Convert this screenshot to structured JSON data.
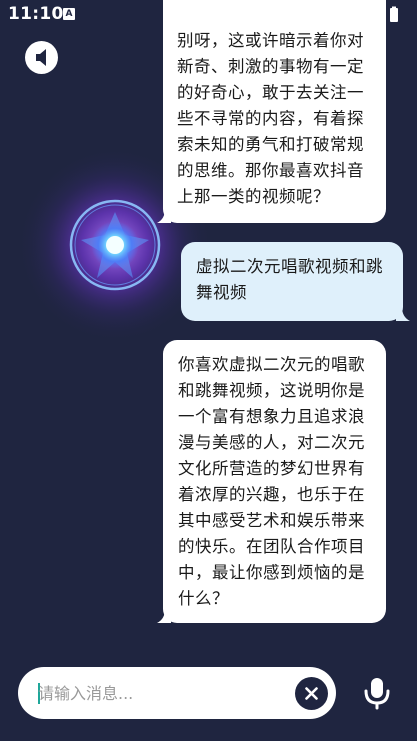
{
  "status_bar": {
    "time": "11:10",
    "app_icon_label": "A"
  },
  "chat": {
    "messages": [
      {
        "role": "ai",
        "text": "别呀，这或许暗示着你对新奇、刺激的事物有一定的好奇心，敢于去关注一些不寻常的内容，有着探索未知的勇气和打破常规的思维。那你最喜欢抖音上那一类的视频呢？"
      },
      {
        "role": "user",
        "text": "虚拟二次元唱歌视频和跳舞视频"
      },
      {
        "role": "ai",
        "text": "你喜欢虚拟二次元的唱歌和跳舞视频，这说明你是一个富有想象力且追求浪漫与美感的人，对二次元文化所营造的梦幻世界有着浓厚的兴趣，也乐于在其中感受艺术和娱乐带来的快乐。在团队合作项目中，最让你感到烦恼的是什么？"
      }
    ]
  },
  "input": {
    "placeholder": "请输入消息...",
    "value": ""
  },
  "colors": {
    "background": "#1f2540",
    "ai_bubble": "#ffffff",
    "user_bubble": "#dff0fb",
    "orb_core": "#6fe8ff",
    "orb_glow": "#9b4dff"
  },
  "icons": {
    "back": "volume-back-icon",
    "clear": "close-icon",
    "mic": "microphone-icon",
    "wifi": "wifi-icon",
    "signal": "signal-icon",
    "battery": "battery-icon"
  }
}
